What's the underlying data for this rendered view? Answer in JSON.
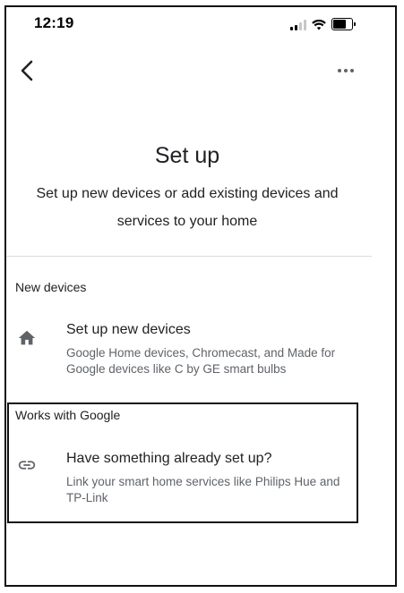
{
  "status_bar": {
    "time": "12:19"
  },
  "nav": {
    "back_icon": "chevron-left-icon",
    "more_icon": "more-horizontal-icon"
  },
  "header": {
    "title": "Set up",
    "subtitle": "Set up new devices or add existing devices and services to your home"
  },
  "sections": {
    "new_devices": {
      "header": "New devices",
      "item": {
        "icon": "home-icon",
        "title": "Set up new devices",
        "description": "Google Home devices, Chromecast, and Made for Google devices like C by GE smart bulbs"
      }
    },
    "works_with_google": {
      "header": "Works with Google",
      "item": {
        "icon": "link-icon",
        "title": "Have something already set up?",
        "description": "Link your smart home services like Philips Hue and TP-Link"
      }
    }
  },
  "colors": {
    "text_primary": "#202124",
    "text_secondary": "#5f6368",
    "icon": "#5f6368",
    "divider": "#dadce0"
  }
}
